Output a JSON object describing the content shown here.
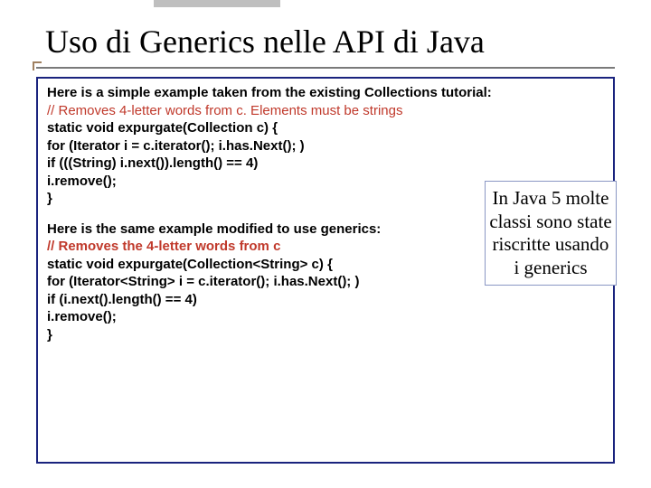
{
  "title": "Uso di Generics nelle API di Java",
  "intro1": "Here is a simple example taken from the existing Collections tutorial:",
  "code1": {
    "comment": "// Removes 4-letter words from c. Elements must be strings",
    "l1": "static void expurgate(Collection c) {",
    "l2": "for (Iterator i = c.iterator(); i.has.Next(); )",
    "l3": "if (((String) i.next()).length() == 4)",
    "l4": "i.remove();",
    "l5": "}"
  },
  "intro2": "Here is the same example modified to use generics:",
  "code2": {
    "comment": "// Removes the 4-letter words from c",
    "l1": "static void expurgate(Collection<String> c) {",
    "l2": "for (Iterator<String> i = c.iterator(); i.has.Next(); )",
    "l3": "if (i.next().length() == 4)",
    "l4": "i.remove();",
    "l5": "}"
  },
  "callout": "In Java 5 molte classi sono state riscritte usando i generics"
}
